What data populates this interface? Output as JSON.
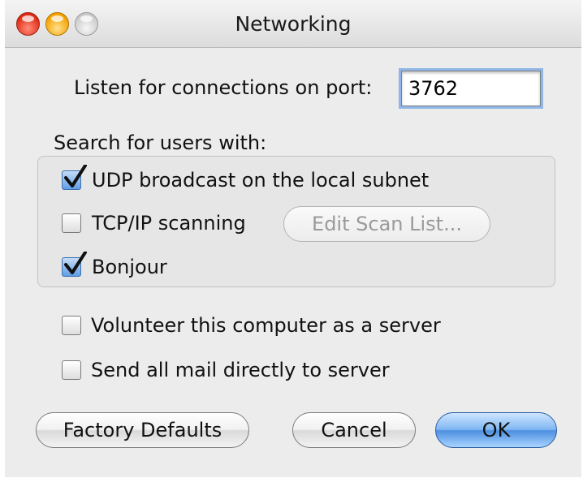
{
  "window": {
    "title": "Networking"
  },
  "port": {
    "label": "Listen for connections on port:",
    "value": "3762"
  },
  "search": {
    "heading": "Search for users with:",
    "options": [
      {
        "label": "UDP broadcast on the local subnet",
        "checked": true
      },
      {
        "label": "TCP/IP scanning",
        "checked": false
      },
      {
        "label": "Bonjour",
        "checked": true
      }
    ],
    "edit_scan_list_label": "Edit Scan List..."
  },
  "options": [
    {
      "label": "Volunteer this computer as a server",
      "checked": false
    },
    {
      "label": "Send all mail directly to server",
      "checked": false
    }
  ],
  "buttons": {
    "factory_defaults": "Factory Defaults",
    "cancel": "Cancel",
    "ok": "OK"
  },
  "colors": {
    "accent": "#4d8fe0",
    "window_bg": "#ececec"
  }
}
